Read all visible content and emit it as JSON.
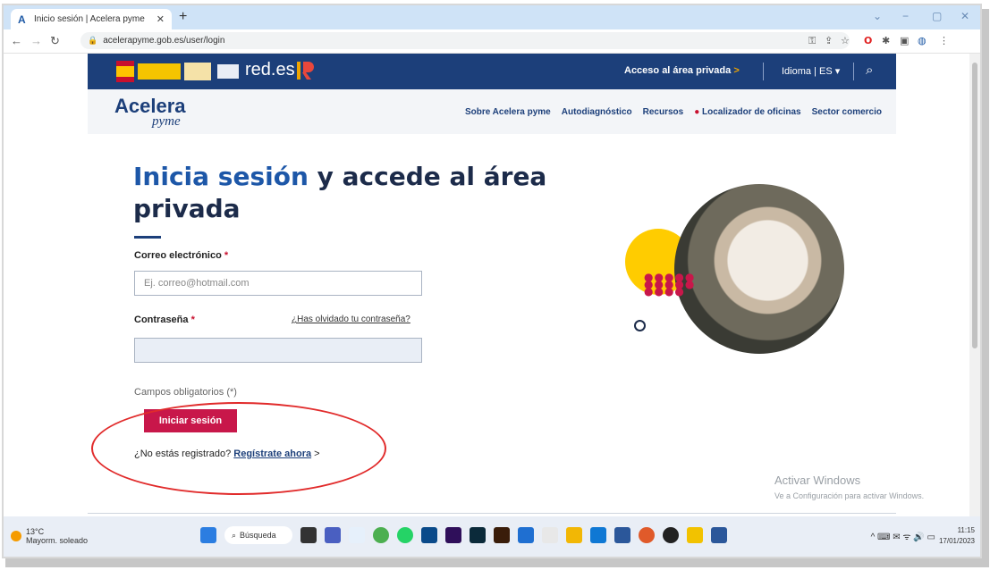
{
  "browser": {
    "tab_title": "Inicio sesión | Acelera pyme",
    "tab_favicon": "A",
    "new_tab": "+",
    "url": "acelerapyme.gob.es/user/login",
    "win_min": "−",
    "win_max": "▢",
    "win_close": "✕"
  },
  "topbar": {
    "reds_label": "red.es",
    "acceso_label": "Acceso al área privada",
    "acceso_arrow": ">",
    "idioma_label": "Idioma | ES ▾"
  },
  "site_nav": {
    "logo_main": "Acelera",
    "logo_sub": "pyme",
    "items": [
      {
        "label": "Sobre Acelera pyme"
      },
      {
        "label": "Autodiagnóstico"
      },
      {
        "label": "Recursos"
      },
      {
        "label": "Localizador de oficinas"
      },
      {
        "label": "Sector comercio"
      }
    ]
  },
  "login": {
    "title_highlight": "Inicia sesión",
    "title_rest": " y accede al área privada",
    "email_label": "Correo electrónico",
    "required_mark": "*",
    "email_placeholder": "Ej. correo@hotmail.com",
    "password_label": "Contraseña",
    "forgot_link": "¿Has olvidado tu contraseña?",
    "required_note": "Campos obligatorios (*)",
    "submit_label": "Iniciar sesión",
    "not_registered": "¿No estás registrado? ",
    "register_link": "Regístrate ahora",
    "register_arrow": " >"
  },
  "watermark": {
    "line1": "Activar Windows",
    "line2": "Ve a Configuración para activar Windows."
  },
  "taskbar": {
    "temperature": "13°C",
    "weather": "Mayorm. soleado",
    "search_label": "Búsqueda",
    "time": "11:15",
    "date": "17/01/2023"
  },
  "colors": {
    "brand_blue": "#1c3f7a",
    "accent_red": "#c8174a",
    "annotation_red": "#e12b2b"
  }
}
